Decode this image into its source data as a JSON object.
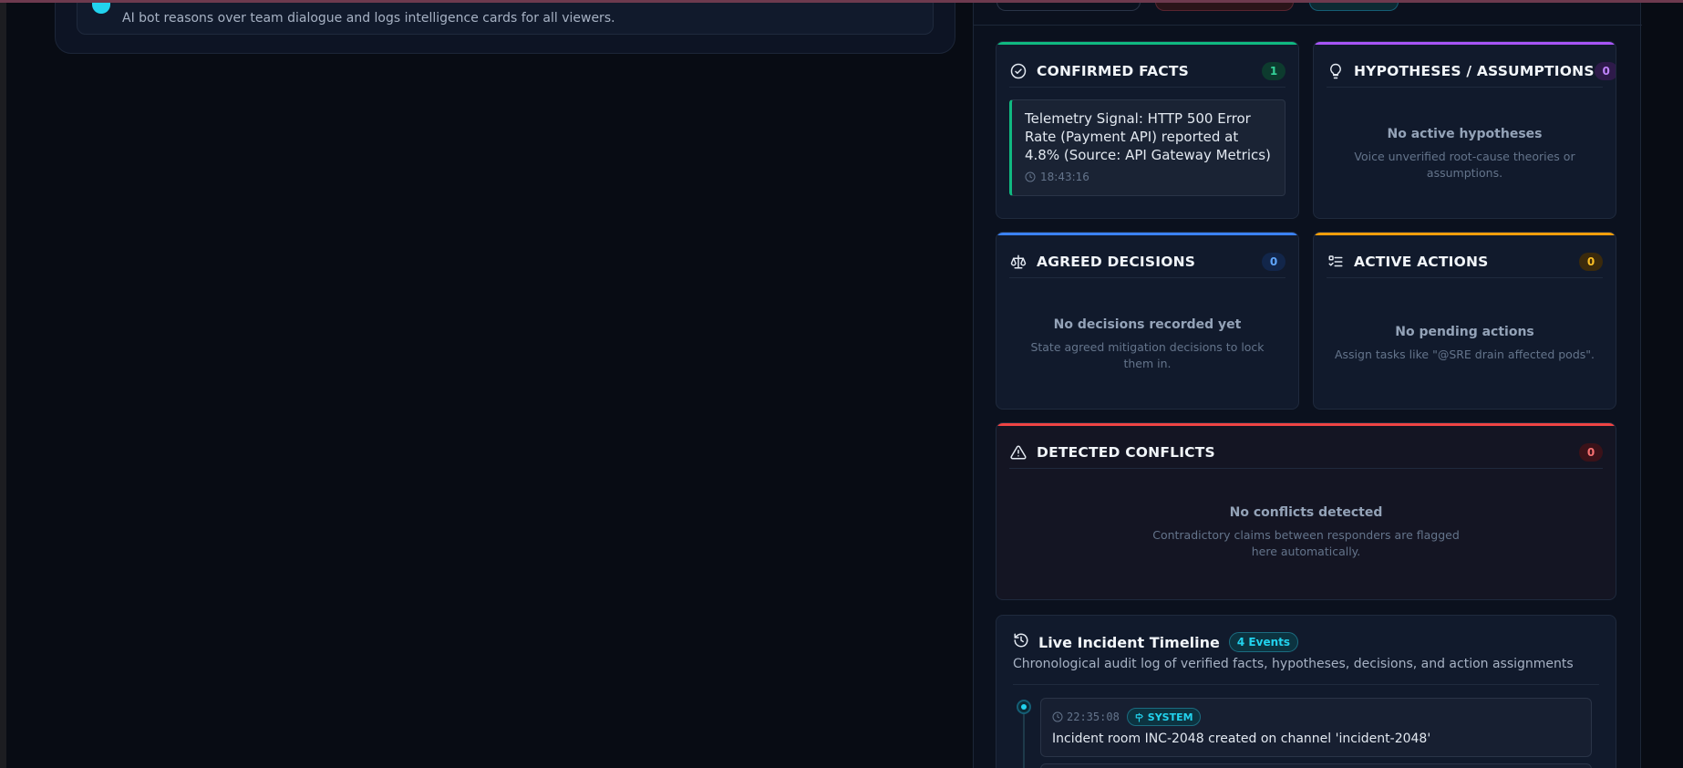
{
  "bot_note": "AI bot reasons over team dialogue and logs intelligence cards for all viewers.",
  "cards": {
    "facts": {
      "title": "CONFIRMED FACTS",
      "count": "1",
      "accent": "#10b981",
      "icon": "check-circle-icon",
      "items": [
        {
          "text": "Telemetry Signal: HTTP 500 Error Rate (Payment API) reported at 4.8% (Source: API Gateway Metrics)",
          "time": "18:43:16"
        }
      ]
    },
    "hypotheses": {
      "title": "HYPOTHESES / ASSUMPTIONS",
      "count": "0",
      "accent": "#a855f7",
      "icon": "lightbulb-icon",
      "empty_title": "No active hypotheses",
      "empty_desc": "Voice unverified root-cause theories or assumptions."
    },
    "decisions": {
      "title": "AGREED DECISIONS",
      "count": "0",
      "accent": "#3b82f6",
      "icon": "scale-icon",
      "empty_title": "No decisions recorded yet",
      "empty_desc": "State agreed mitigation decisions to lock them in."
    },
    "actions": {
      "title": "ACTIVE ACTIONS",
      "count": "0",
      "accent": "#f59e0b",
      "icon": "checklist-icon",
      "empty_title": "No pending actions",
      "empty_desc": "Assign tasks like \"@SRE drain affected pods\"."
    },
    "conflicts": {
      "title": "DETECTED CONFLICTS",
      "count": "0",
      "accent": "#ef4444",
      "icon": "warning-icon",
      "empty_title": "No conflicts detected",
      "empty_desc": "Contradictory claims between responders are flagged here automatically."
    }
  },
  "timeline": {
    "title": "Live Incident Timeline",
    "badge": "4 Events",
    "subtitle": "Chronological audit log of verified facts, hypotheses, decisions, and action assignments",
    "events": [
      {
        "time": "22:35:08",
        "type": "SYSTEM",
        "text": "Incident room INC-2048 created on channel 'incident-2048'"
      }
    ]
  }
}
